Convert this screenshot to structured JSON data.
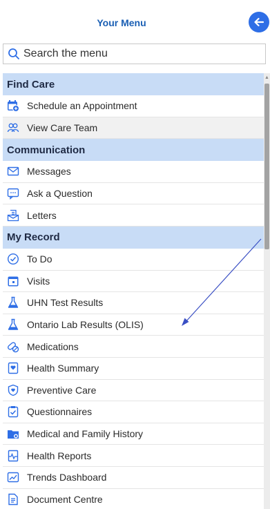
{
  "header": {
    "title": "Your Menu"
  },
  "search": {
    "placeholder": "Search the menu"
  },
  "colors": {
    "accent": "#1a5fb4",
    "section_bg": "#c8dcf6",
    "icon_blue": "#2e6ee6"
  },
  "menu": {
    "find_care": {
      "title": "Find Care",
      "items": [
        {
          "label": "Schedule an Appointment",
          "icon": "calendar-plus-icon"
        },
        {
          "label": "View Care Team",
          "icon": "care-team-icon"
        }
      ]
    },
    "communication": {
      "title": "Communication",
      "items": [
        {
          "label": "Messages",
          "icon": "envelope-icon"
        },
        {
          "label": "Ask a Question",
          "icon": "chat-icon"
        },
        {
          "label": "Letters",
          "icon": "letter-icon"
        }
      ]
    },
    "my_record": {
      "title": "My Record",
      "items": [
        {
          "label": "To Do",
          "icon": "clock-check-icon"
        },
        {
          "label": "Visits",
          "icon": "calendar-icon"
        },
        {
          "label": "UHN Test Results",
          "icon": "flask-icon"
        },
        {
          "label": "Ontario Lab Results (OLIS)",
          "icon": "flask-icon"
        },
        {
          "label": "Medications",
          "icon": "pills-icon"
        },
        {
          "label": "Health Summary",
          "icon": "health-summary-icon"
        },
        {
          "label": "Preventive Care",
          "icon": "shield-icon"
        },
        {
          "label": "Questionnaires",
          "icon": "checklist-icon"
        },
        {
          "label": "Medical and Family History",
          "icon": "folder-icon"
        },
        {
          "label": "Health Reports",
          "icon": "pulse-report-icon"
        },
        {
          "label": "Trends Dashboard",
          "icon": "trend-chart-icon"
        },
        {
          "label": "Document Centre",
          "icon": "document-icon"
        }
      ]
    }
  }
}
